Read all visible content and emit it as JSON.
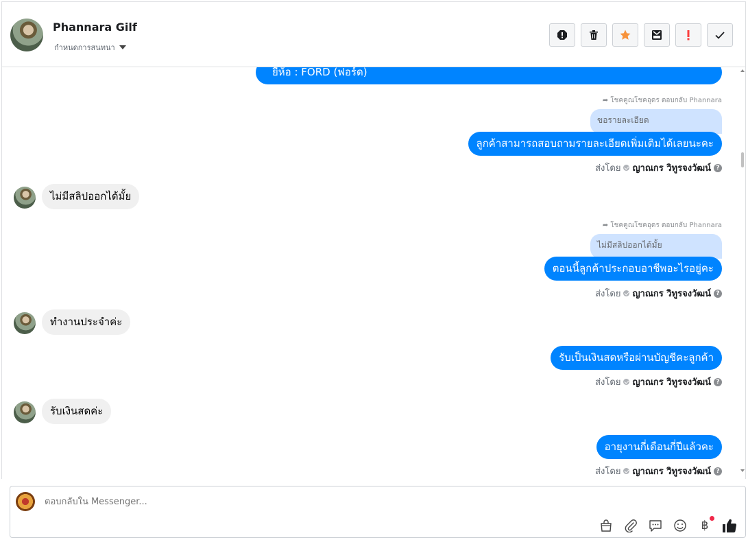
{
  "header": {
    "name": "Phannara Gilf",
    "assign_label": "กำหนดการสนทนา",
    "actions": [
      "spam-icon",
      "trash-icon",
      "star-icon",
      "archive-icon",
      "important-icon",
      "done-icon"
    ]
  },
  "messages": {
    "top_partial": "ยี่ห้อ : FORD (ฟอร์ด)",
    "reply1_meta": "โชคคูณโชคอุดร ตอบกลับ Phannara",
    "quote1": "ขอรายละเอียด",
    "out1": "ลูกค้าสามารถสอบถามรายละเอียดเพิ่มเติมได้เลยนะคะ",
    "sent_prefix": "ส่งโดย",
    "agent": "ญาณกร วิทูรจงวัฒน์",
    "in1": "ไม่มีสลิปออกได้มั้ย",
    "reply2_meta": "โชคคูณโชคอุดร ตอบกลับ Phannara",
    "quote2": "ไม่มีสลิปออกได้มั้ย",
    "out2": "ตอนนี้ลูกค้าประกอบอาชีพอะไรอยู่คะ",
    "in2": "ทำงานประจำค่ะ",
    "out3": "รับเป็นเงินสดหรือผ่านบัญชีคะลูกค้า",
    "in3": "รับเงินสดค่ะ",
    "out4": "อายุงานกี่เดือนกี่ปีแล้วคะ"
  },
  "composer": {
    "placeholder": "ตอบกลับใน Messenger...",
    "tools": [
      "bag-icon",
      "attachment-icon",
      "saved-reply-icon",
      "emoji-icon",
      "baht-icon",
      "like-icon"
    ]
  },
  "colors": {
    "accent": "#0084ff",
    "quote": "#cfe3ff",
    "incoming": "#f0f0f0",
    "star": "#f7923a",
    "important": "#fa3e3e"
  }
}
